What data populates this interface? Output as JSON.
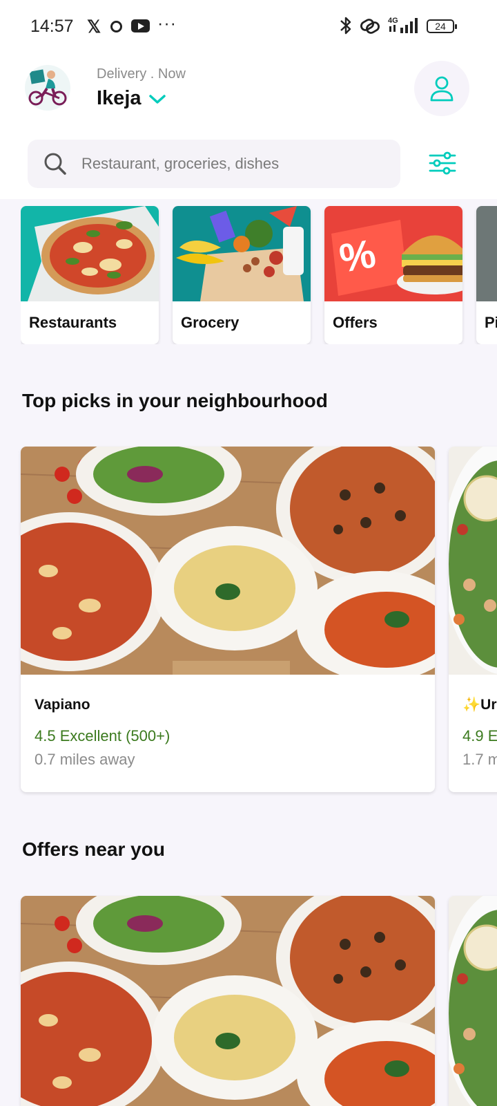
{
  "status_bar": {
    "time": "14:57",
    "x_glyph": "𝕏",
    "more": "···",
    "network": "4G",
    "battery": "24",
    "icons": [
      "x-icon",
      "ring-icon",
      "youtube-icon",
      "bluetooth-icon",
      "link-icon",
      "signal-icon",
      "battery-icon"
    ]
  },
  "header": {
    "delivery_label": "Delivery . Now",
    "location": "Ikeja",
    "accent_color": "#00ccbc"
  },
  "search": {
    "placeholder": "Restaurant, groceries, dishes"
  },
  "categories": [
    {
      "label": "Restaurants"
    },
    {
      "label": "Grocery"
    },
    {
      "label": "Offers"
    },
    {
      "label": "Pi"
    }
  ],
  "sections": {
    "top_picks": {
      "title": "Top picks in your neighbourhood",
      "cards": [
        {
          "name": "Vapiano",
          "rating": "4.5 Excellent (500+)",
          "distance": "0.7 miles away"
        },
        {
          "name": "✨Ur",
          "rating": "4.9 E",
          "distance": "1.7 m"
        }
      ]
    },
    "offers_near_you": {
      "title": "Offers near you"
    }
  },
  "colors": {
    "rating_green": "#3b7a1e",
    "muted_text": "#8b8b8b",
    "page_bg": "#f7f5fb"
  }
}
